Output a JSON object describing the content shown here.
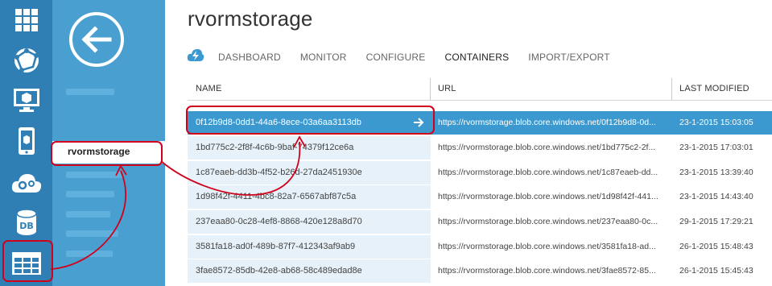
{
  "rail": {
    "items": [
      {
        "icon": "all-items-grid-icon"
      },
      {
        "icon": "web-sites-globe-icon"
      },
      {
        "icon": "virtual-machine-monitor-icon"
      },
      {
        "icon": "mobile-services-phone-icon"
      },
      {
        "icon": "cloud-services-gears-icon"
      },
      {
        "icon": "sql-database-db-icon"
      },
      {
        "icon": "storage-table-icon"
      }
    ],
    "db_label": "DB"
  },
  "nav2": {
    "back_icon": "back-arrow-icon",
    "selected_item": "rvormstorage"
  },
  "page": {
    "title": "rvormstorage",
    "tabs": [
      "DASHBOARD",
      "MONITOR",
      "CONFIGURE",
      "CONTAINERS",
      "IMPORT/EXPORT"
    ],
    "active_tab": "CONTAINERS"
  },
  "table": {
    "columns": [
      "NAME",
      "URL",
      "LAST MODIFIED"
    ],
    "rows": [
      {
        "name": "0f12b9d8-0dd1-44a6-8ece-03a6aa3113db",
        "url": "https://rvormstorage.blob.core.windows.net/0f12b9d8-0d...",
        "modified": "23-1-2015 15:03:05",
        "selected": true
      },
      {
        "name": "1bd775c2-2f8f-4c6b-9baf-74379f12ce6a",
        "url": "https://rvormstorage.blob.core.windows.net/1bd775c2-2f...",
        "modified": "23-1-2015 17:03:01"
      },
      {
        "name": "1c87eaeb-dd3b-4f52-b26d-27da2451930e",
        "url": "https://rvormstorage.blob.core.windows.net/1c87eaeb-dd...",
        "modified": "23-1-2015 13:39:40"
      },
      {
        "name": "1d98f42f-4411-4bc8-82a7-6567abf87c5a",
        "url": "https://rvormstorage.blob.core.windows.net/1d98f42f-441...",
        "modified": "23-1-2015 14:43:40"
      },
      {
        "name": "237eaa80-0c28-4ef8-8868-420e128a8d70",
        "url": "https://rvormstorage.blob.core.windows.net/237eaa80-0c...",
        "modified": "29-1-2015 17:29:21"
      },
      {
        "name": "3581fa18-ad0f-489b-87f7-412343af9ab9",
        "url": "https://rvormstorage.blob.core.windows.net/3581fa18-ad...",
        "modified": "26-1-2015 15:48:43"
      },
      {
        "name": "3fae8572-85db-42e8-ab68-58c489edad8e",
        "url": "https://rvormstorage.blob.core.windows.net/3fae8572-85...",
        "modified": "26-1-2015 15:45:43"
      }
    ]
  },
  "colors": {
    "rail_bg": "#2f7fb5",
    "nav_bg": "#4a9fd1",
    "selected_row": "#3b99cf",
    "annotation_red": "#d0021b"
  }
}
